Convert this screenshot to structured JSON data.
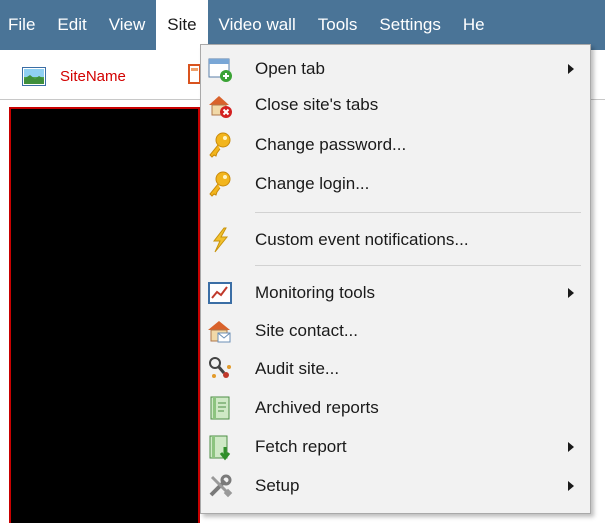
{
  "menubar": {
    "items": [
      {
        "label": "File"
      },
      {
        "label": "Edit"
      },
      {
        "label": "View"
      },
      {
        "label": "Site"
      },
      {
        "label": "Video wall"
      },
      {
        "label": "Tools"
      },
      {
        "label": "Settings"
      },
      {
        "label": "He"
      }
    ],
    "active": "Site"
  },
  "toolbar": {
    "site_tab": {
      "label": "SiteName",
      "icon": "site-tab-icon"
    }
  },
  "site_menu": {
    "items": [
      {
        "label": "Open tab",
        "icon": "open-tab-icon",
        "submenu": true
      },
      {
        "label": "Close site's tabs",
        "icon": "close-tabs-icon",
        "submenu": false
      },
      {
        "label": "Change password...",
        "icon": "key-icon",
        "submenu": false
      },
      {
        "label": "Change login...",
        "icon": "key-icon",
        "submenu": false
      },
      {
        "label": "Custom event notifications...",
        "icon": "lightning-icon",
        "submenu": false
      },
      {
        "label": "Monitoring tools",
        "icon": "monitoring-icon",
        "submenu": true
      },
      {
        "label": "Site contact...",
        "icon": "site-contact-icon",
        "submenu": false
      },
      {
        "label": "Audit site...",
        "icon": "audit-icon",
        "submenu": false
      },
      {
        "label": "Archived reports",
        "icon": "archived-reports-icon",
        "submenu": false
      },
      {
        "label": "Fetch report",
        "icon": "fetch-report-icon",
        "submenu": true
      },
      {
        "label": "Setup",
        "icon": "setup-tools-icon",
        "submenu": true
      }
    ]
  },
  "colors": {
    "menubar_bg": "#4a7497",
    "menu_bg": "#f2f2f2",
    "site_name": "#d20000",
    "video_border": "#c80000"
  }
}
